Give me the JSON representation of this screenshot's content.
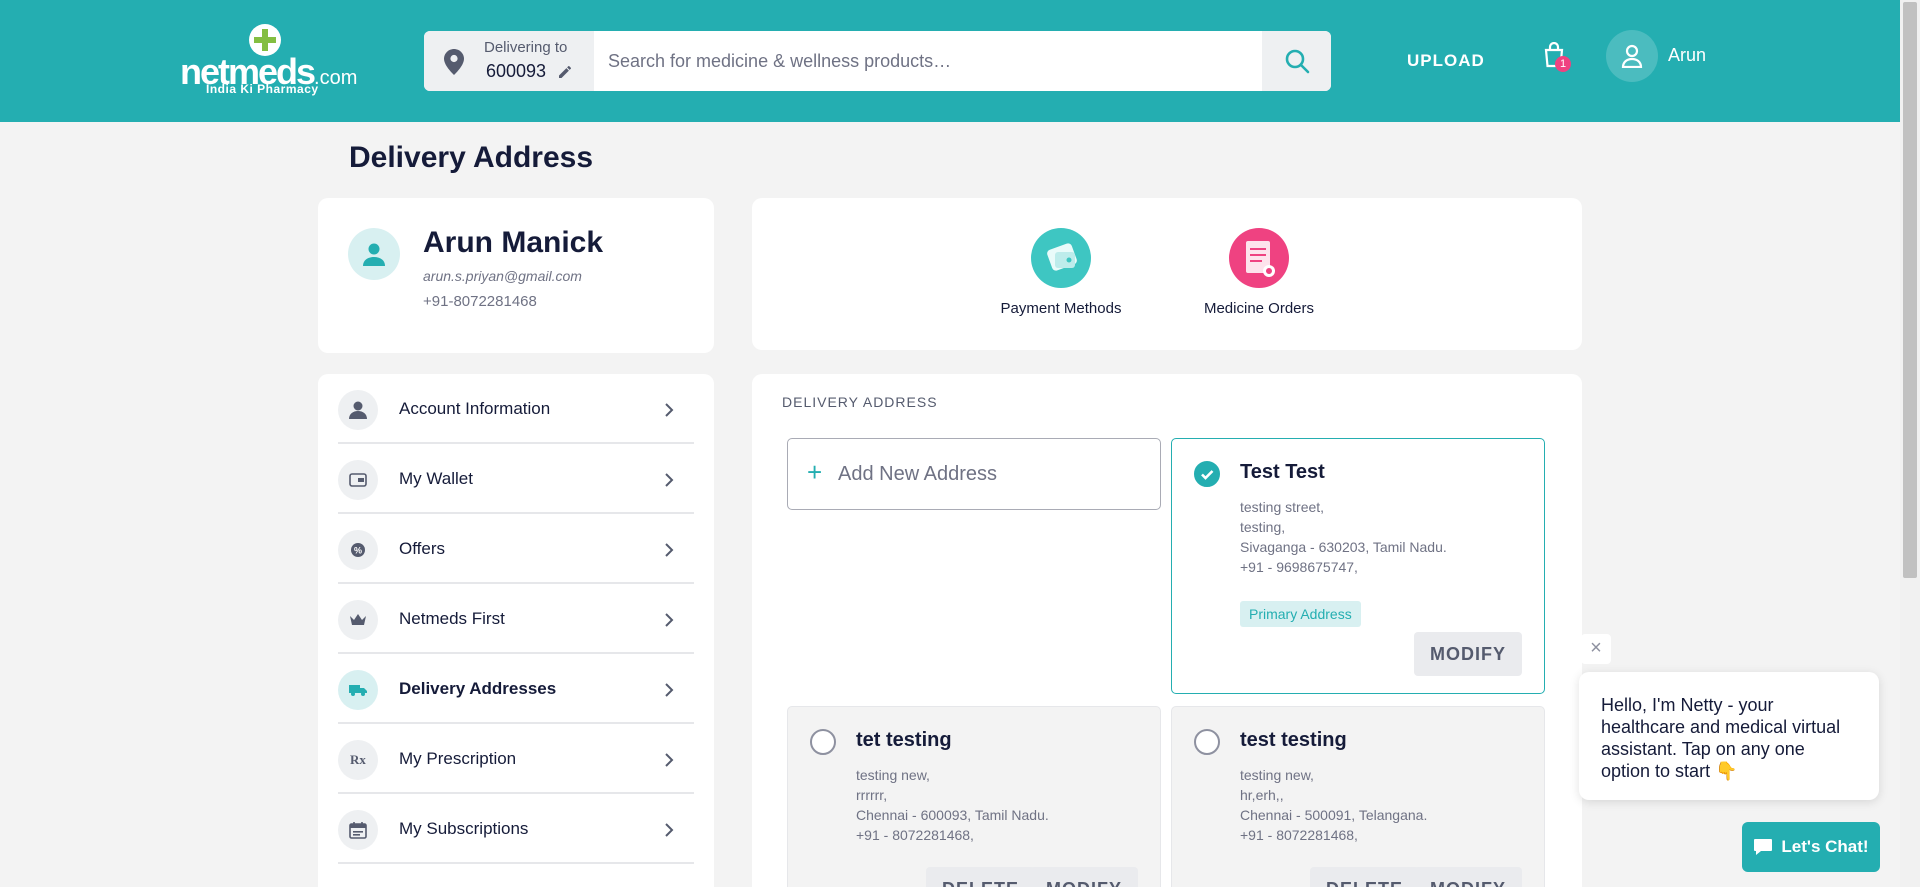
{
  "header": {
    "logo": {
      "brand": "netmeds",
      "suffix": ".com",
      "tagline": "India Ki Pharmacy"
    },
    "delivering_label": "Delivering to",
    "pincode": "600093",
    "search_placeholder": "Search for medicine & wellness products…",
    "upload_label": "UPLOAD",
    "cart_count": "1",
    "user_name": "Arun"
  },
  "page_title": "Delivery Address",
  "profile": {
    "name": "Arun Manick",
    "email": "arun.s.priyan@gmail.com",
    "phone": "+91-8072281468"
  },
  "quick_links": [
    {
      "label": "Payment Methods",
      "icon": "wallet-icon"
    },
    {
      "label": "Medicine Orders",
      "icon": "orders-icon"
    }
  ],
  "sidebar": {
    "items": [
      {
        "label": "Account Information",
        "icon": "user-icon"
      },
      {
        "label": "My Wallet",
        "icon": "wallet-icon"
      },
      {
        "label": "Offers",
        "icon": "offer-icon"
      },
      {
        "label": "Netmeds First",
        "icon": "crown-icon"
      },
      {
        "label": "Delivery Addresses",
        "icon": "truck-icon",
        "active": true
      },
      {
        "label": "My Prescription",
        "icon": "Rx"
      },
      {
        "label": "My Subscriptions",
        "icon": "calendar-icon"
      }
    ]
  },
  "addresses": {
    "title": "DELIVERY ADDRESS",
    "add_new_label": "Add New Address",
    "primary_tag": "Primary Address",
    "modify_label": "MODIFY",
    "delete_label": "DELETE",
    "list": [
      {
        "name": "Test Test",
        "lines": [
          "testing street,",
          "testing,",
          "Sivaganga - 630203, Tamil Nadu.",
          "+91 - 9698675747,"
        ],
        "selected": true
      },
      {
        "name": "tet testing",
        "lines": [
          "testing new,",
          "rrrrrr,",
          "Chennai - 600093, Tamil Nadu.",
          "+91 - 8072281468,"
        ],
        "selected": false
      },
      {
        "name": "test testing",
        "lines": [
          "testing new,",
          "hr,erh,,",
          "Chennai - 500091, Telangana.",
          "+91 - 8072281468,"
        ],
        "selected": false
      }
    ]
  },
  "chat": {
    "close": "×",
    "message": "Hello, I'm Netty - your healthcare and medical virtual assistant. Tap on any one option to start 👇",
    "button_label": "Let's Chat!"
  },
  "colors": {
    "brand": "#24aeb1",
    "accent_pink": "#ef4281",
    "text_dark": "#151b39"
  }
}
